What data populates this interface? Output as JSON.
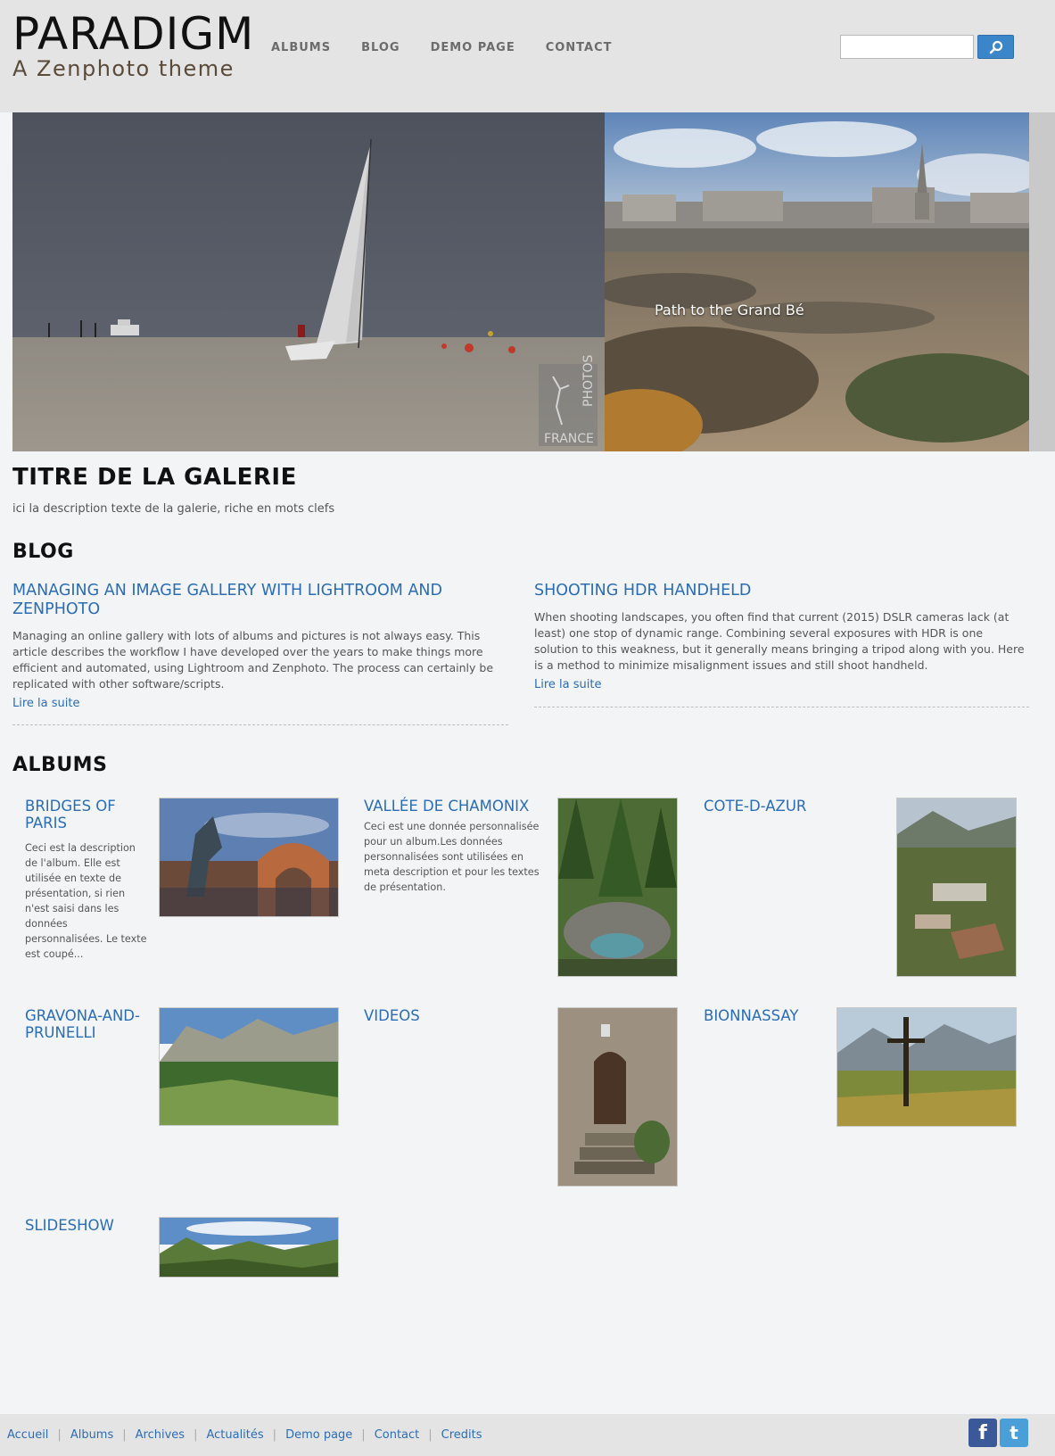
{
  "site": {
    "title": "PARADIGM",
    "subtitle": "A Zenphoto theme"
  },
  "nav": {
    "items": [
      "ALBUMS",
      "BLOG",
      "DEMO PAGE",
      "CONTACT"
    ]
  },
  "search": {
    "value": "",
    "icon": "search-icon"
  },
  "slider": {
    "caption": "Path to the Grand Bé",
    "watermark_top": "PHOTOS",
    "watermark_bottom": "FRANCE"
  },
  "gallery": {
    "title": "TITRE DE LA GALERIE",
    "description": "ici la description texte de la galerie, riche en mots clefs"
  },
  "blog": {
    "heading": "BLOG",
    "posts": [
      {
        "title": "MANAGING AN IMAGE GALLERY WITH LIGHTROOM AND ZENPHOTO",
        "excerpt": "Managing an online gallery with lots of albums and pictures is not always easy. This article describes the workflow I have developed over the years to make things more efficient and automated, using Lightroom and Zenphoto. The process can certainly be replicated with other software/scripts.",
        "read_more": "Lire la suite"
      },
      {
        "title": "SHOOTING HDR HANDHELD",
        "excerpt": "When shooting landscapes, you often find that current (2015) DSLR cameras lack (at least) one stop of dynamic range. Combining several exposures with HDR is one solution to this weakness, but it generally means bringing a tripod along with you. Here is a method to minimize misalignment issues and still shoot handheld.",
        "read_more": "Lire la suite"
      }
    ]
  },
  "albums": {
    "heading": "ALBUMS",
    "items": [
      {
        "title": "BRIDGES OF PARIS",
        "description": "Ceci est la description de l'album. Elle est utilisée en texte de présentation, si rien n'est saisi dans les données personnalisées. Le texte est coupé..."
      },
      {
        "title": "VALLÉE DE CHAMONIX",
        "description": "Ceci est une donnée personnalisée pour un album.Les données personnalisées sont utilisées en meta description et pour les textes de présentation."
      },
      {
        "title": "COTE-D-AZUR",
        "description": ""
      },
      {
        "title": "GRAVONA-AND-PRUNELLI",
        "description": ""
      },
      {
        "title": "VIDEOS",
        "description": ""
      },
      {
        "title": "BIONNASSAY",
        "description": ""
      },
      {
        "title": "SLIDESHOW",
        "description": ""
      }
    ]
  },
  "footer": {
    "links": [
      "Accueil",
      "Albums",
      "Archives",
      "Actualités",
      "Demo page",
      "Contact",
      "Credits"
    ],
    "social": [
      {
        "name": "facebook-icon",
        "glyph": "f",
        "color": "#3b5998"
      },
      {
        "name": "twitter-icon",
        "glyph": "t",
        "color": "#4a9fd8"
      }
    ]
  },
  "colors": {
    "accent": "#2a6db5",
    "header_bg": "#e4e4e4",
    "page_bg": "#f3f4f6",
    "search_button": "#3a86c8"
  }
}
